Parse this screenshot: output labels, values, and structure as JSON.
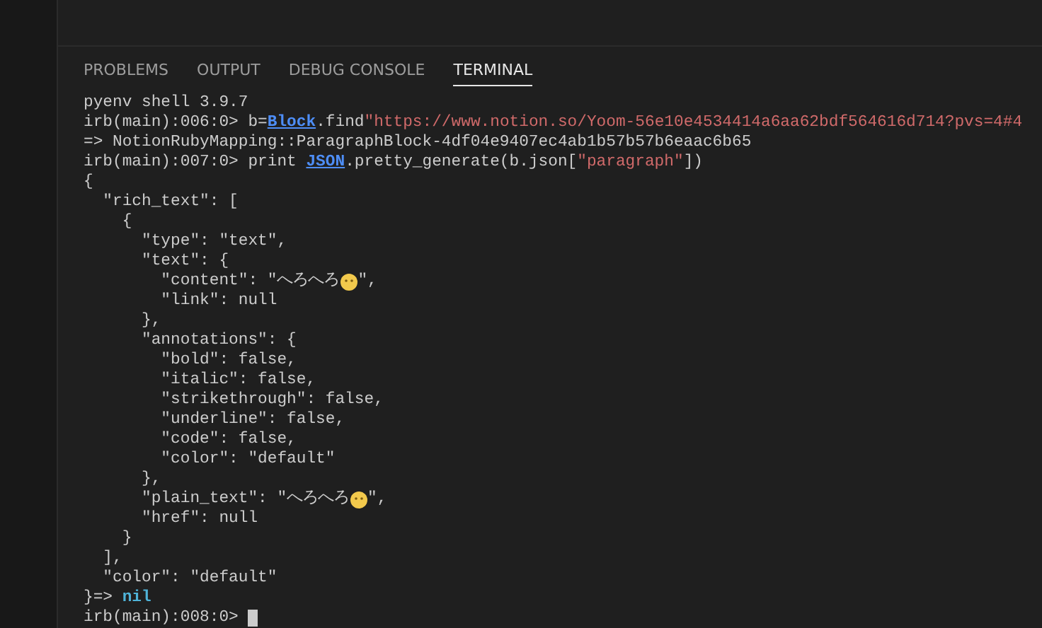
{
  "panel_tabs": [
    {
      "label": "PROBLEMS",
      "selected": false
    },
    {
      "label": "OUTPUT",
      "selected": false
    },
    {
      "label": "DEBUG CONSOLE",
      "selected": false
    },
    {
      "label": "TERMINAL",
      "selected": true
    }
  ],
  "terminal": {
    "lines": [
      {
        "segments": [
          {
            "kind": "plain",
            "text": "pyenv shell 3.9.7"
          }
        ]
      },
      {
        "segments": [
          {
            "kind": "plain",
            "text": "irb(main):006:0> b="
          },
          {
            "kind": "class",
            "text": "Block"
          },
          {
            "kind": "plain",
            "text": ".find"
          },
          {
            "kind": "string",
            "text": "\"https://www.notion.so/Yoom-56e10e4534414a6aa62bdf564616d714?pvs=4#4"
          }
        ]
      },
      {
        "segments": [
          {
            "kind": "plain",
            "text": "=> NotionRubyMapping::ParagraphBlock-4df04e9407ec4ab1b57b57b6eaac6b65"
          }
        ]
      },
      {
        "segments": [
          {
            "kind": "plain",
            "text": "irb(main):007:0> print "
          },
          {
            "kind": "class",
            "text": "JSON"
          },
          {
            "kind": "plain",
            "text": ".pretty_generate(b.json["
          },
          {
            "kind": "string",
            "text": "\"paragraph\""
          },
          {
            "kind": "plain",
            "text": "])"
          }
        ]
      },
      {
        "segments": [
          {
            "kind": "plain",
            "text": "{"
          }
        ]
      },
      {
        "segments": [
          {
            "kind": "plain",
            "text": "  \"rich_text\": ["
          }
        ]
      },
      {
        "segments": [
          {
            "kind": "plain",
            "text": "    {"
          }
        ]
      },
      {
        "segments": [
          {
            "kind": "plain",
            "text": "      \"type\": \"text\","
          }
        ]
      },
      {
        "segments": [
          {
            "kind": "plain",
            "text": "      \"text\": {"
          }
        ]
      },
      {
        "segments": [
          {
            "kind": "plain",
            "text": "        \"content\": \"へろへろ"
          },
          {
            "kind": "emoji"
          },
          {
            "kind": "plain",
            "text": "\","
          }
        ]
      },
      {
        "segments": [
          {
            "kind": "plain",
            "text": "        \"link\": null"
          }
        ]
      },
      {
        "segments": [
          {
            "kind": "plain",
            "text": "      },"
          }
        ]
      },
      {
        "segments": [
          {
            "kind": "plain",
            "text": "      \"annotations\": {"
          }
        ]
      },
      {
        "segments": [
          {
            "kind": "plain",
            "text": "        \"bold\": false,"
          }
        ]
      },
      {
        "segments": [
          {
            "kind": "plain",
            "text": "        \"italic\": false,"
          }
        ]
      },
      {
        "segments": [
          {
            "kind": "plain",
            "text": "        \"strikethrough\": false,"
          }
        ]
      },
      {
        "segments": [
          {
            "kind": "plain",
            "text": "        \"underline\": false,"
          }
        ]
      },
      {
        "segments": [
          {
            "kind": "plain",
            "text": "        \"code\": false,"
          }
        ]
      },
      {
        "segments": [
          {
            "kind": "plain",
            "text": "        \"color\": \"default\""
          }
        ]
      },
      {
        "segments": [
          {
            "kind": "plain",
            "text": "      },"
          }
        ]
      },
      {
        "segments": [
          {
            "kind": "plain",
            "text": "      \"plain_text\": \"へろへろ"
          },
          {
            "kind": "emoji"
          },
          {
            "kind": "plain",
            "text": "\","
          }
        ]
      },
      {
        "segments": [
          {
            "kind": "plain",
            "text": "      \"href\": null"
          }
        ]
      },
      {
        "segments": [
          {
            "kind": "plain",
            "text": "    }"
          }
        ]
      },
      {
        "segments": [
          {
            "kind": "plain",
            "text": "  ],"
          }
        ]
      },
      {
        "segments": [
          {
            "kind": "plain",
            "text": "  \"color\": \"default\""
          }
        ]
      },
      {
        "segments": [
          {
            "kind": "plain",
            "text": "}=> "
          },
          {
            "kind": "keyword",
            "text": "nil"
          }
        ]
      },
      {
        "segments": [
          {
            "kind": "plain",
            "text": "irb(main):008:0> "
          }
        ],
        "cursor": true
      }
    ]
  }
}
